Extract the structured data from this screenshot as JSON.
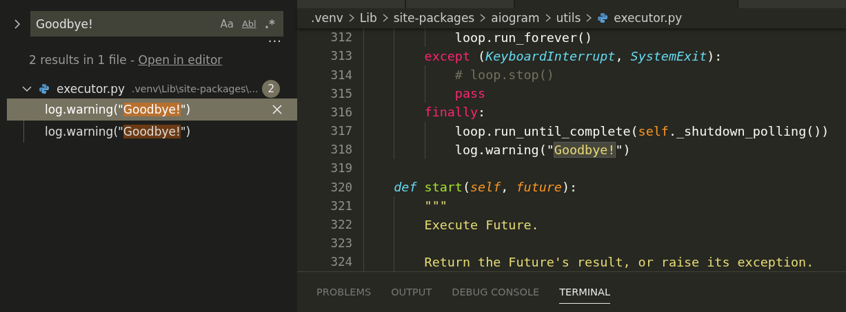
{
  "search": {
    "value": "Goodbye!",
    "options": [
      {
        "label": "Aa",
        "kind": "case"
      },
      {
        "label": "Abl",
        "kind": "word"
      },
      {
        "label": ".*",
        "kind": "regex"
      }
    ],
    "more": "···"
  },
  "summary": {
    "text": "2 results in 1 file - ",
    "link": "Open in editor"
  },
  "file": {
    "name": "executor.py",
    "path": ".venv\\Lib\\site-packages\\...",
    "count": "2",
    "expanded": true,
    "matches": [
      {
        "before": "log.warning(\"",
        "match": "Goodbye!",
        "after": "\")",
        "selected": true
      },
      {
        "before": "log.warning(\"",
        "match": "Goodbye!",
        "after": "\")",
        "selected": false
      }
    ]
  },
  "breadcrumb": [
    ".venv",
    "Lib",
    "site-packages",
    "aiogram",
    "utils",
    "executor.py"
  ],
  "code": [
    {
      "number": "312",
      "tokens": [
        {
          "text": "            loop.run_forever()",
          "kind": "plain"
        }
      ]
    },
    {
      "number": "313",
      "tokens": [
        {
          "text": "        except",
          "kind": "keyword"
        },
        {
          "text": " (",
          "kind": "plain"
        },
        {
          "text": "KeyboardInterrupt",
          "kind": "type"
        },
        {
          "text": ", ",
          "kind": "plain"
        },
        {
          "text": "SystemExit",
          "kind": "type"
        },
        {
          "text": "):",
          "kind": "plain"
        }
      ]
    },
    {
      "number": "314",
      "tokens": [
        {
          "text": "            # loop.stop()",
          "kind": "comment"
        }
      ]
    },
    {
      "number": "315",
      "tokens": [
        {
          "text": "            pass",
          "kind": "keyword"
        }
      ]
    },
    {
      "number": "316",
      "tokens": [
        {
          "text": "        finally",
          "kind": "keyword"
        },
        {
          "text": ":",
          "kind": "plain"
        }
      ]
    },
    {
      "number": "317",
      "tokens": [
        {
          "text": "            loop.run_until_complete(",
          "kind": "plain"
        },
        {
          "text": "self",
          "kind": "self"
        },
        {
          "text": "._shutdown_polling())",
          "kind": "plain"
        }
      ]
    },
    {
      "number": "318",
      "tokens": [
        {
          "text": "            log.warning(\"",
          "kind": "plain"
        },
        {
          "text": "Goodbye!",
          "kind": "match"
        },
        {
          "text": "\")",
          "kind": "plain"
        }
      ]
    },
    {
      "number": "319"
    },
    {
      "number": "320",
      "tokens": [
        {
          "text": "    def ",
          "kind": "def"
        },
        {
          "text": "start",
          "kind": "func"
        },
        {
          "text": "(",
          "kind": "plain"
        },
        {
          "text": "self",
          "kind": "param"
        },
        {
          "text": ", ",
          "kind": "plain"
        },
        {
          "text": "future",
          "kind": "param"
        },
        {
          "text": "):",
          "kind": "plain"
        }
      ]
    },
    {
      "number": "321",
      "tokens": [
        {
          "text": "        \"\"\"",
          "kind": "string"
        }
      ]
    },
    {
      "number": "322",
      "tokens": [
        {
          "text": "        Execute Future.",
          "kind": "string"
        }
      ]
    },
    {
      "number": "323"
    },
    {
      "number": "324",
      "tokens": [
        {
          "text": "        Return the Future's result, or raise its exception.",
          "kind": "string"
        }
      ]
    }
  ],
  "panel_tabs": [
    {
      "label": "PROBLEMS",
      "selected": false
    },
    {
      "label": "OUTPUT",
      "selected": false
    },
    {
      "label": "DEBUG CONSOLE",
      "selected": false
    },
    {
      "label": "TERMINAL",
      "selected": true
    }
  ]
}
